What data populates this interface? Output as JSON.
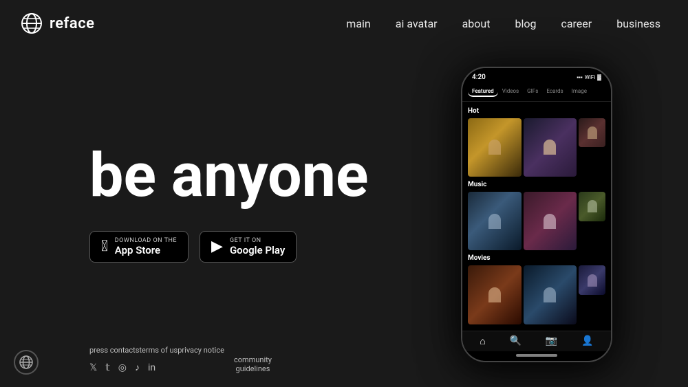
{
  "logo": {
    "text": "reface"
  },
  "nav": {
    "items": [
      {
        "id": "main",
        "label": "main"
      },
      {
        "id": "ai-avatar",
        "label": "ai avatar"
      },
      {
        "id": "about",
        "label": "about"
      },
      {
        "id": "blog",
        "label": "blog"
      },
      {
        "id": "career",
        "label": "career"
      },
      {
        "id": "business",
        "label": "business"
      }
    ]
  },
  "hero": {
    "headline": "be anyone"
  },
  "store_buttons": {
    "app_store": {
      "label": "Download on the",
      "name": "App Store"
    },
    "google_play": {
      "label": "GET IT ON",
      "name": "Google Play"
    }
  },
  "phone": {
    "status_time": "4:20",
    "tabs": [
      "Featured",
      "Videos",
      "GIFs",
      "Ecards",
      "Images"
    ],
    "active_tab": "Featured",
    "sections": [
      {
        "id": "hot",
        "label": "Hot"
      },
      {
        "id": "music",
        "label": "Music"
      },
      {
        "id": "movies",
        "label": "Movies"
      }
    ]
  },
  "footer": {
    "links": [
      {
        "id": "press-contacts",
        "label": "press contacts"
      },
      {
        "id": "terms-of-us",
        "label": "terms of us"
      },
      {
        "id": "privacy-notice",
        "label": "privacy notice"
      }
    ],
    "community": {
      "line1": "community",
      "line2": "guidelines"
    },
    "social": [
      "𝕏",
      "𝕋",
      "📷",
      "𝕕",
      "in"
    ]
  }
}
